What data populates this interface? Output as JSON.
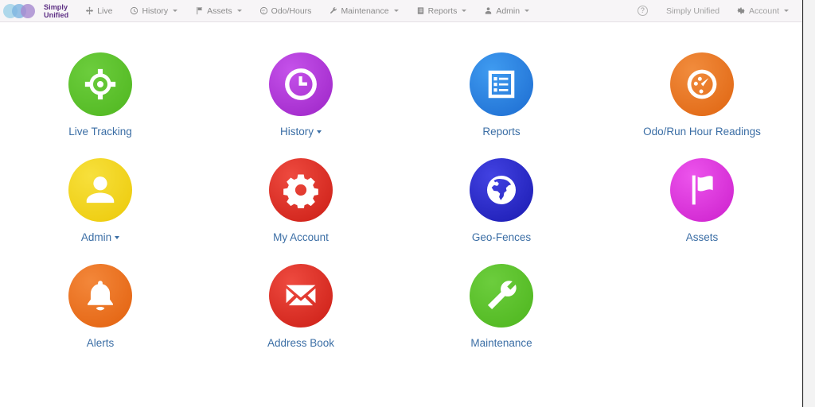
{
  "brand": {
    "line1": "Simply",
    "line2": "Unified",
    "logo_icon": "three-circles-logo"
  },
  "navbar": {
    "left_items": [
      {
        "label": "Live",
        "icon": "crosshair-icon",
        "caret": false
      },
      {
        "label": "History",
        "icon": "clock-icon",
        "caret": true
      },
      {
        "label": "Assets",
        "icon": "flag-icon",
        "caret": true
      },
      {
        "label": "Odo/Hours",
        "icon": "gauge-icon",
        "caret": false
      },
      {
        "label": "Maintenance",
        "icon": "wrench-icon",
        "caret": true
      },
      {
        "label": "Reports",
        "icon": "report-icon",
        "caret": true
      },
      {
        "label": "Admin",
        "icon": "user-icon",
        "caret": true
      }
    ],
    "help_label": "?",
    "help_icon": "help-circle-icon",
    "account_name": "Simply Unified",
    "account_menu": {
      "label": "Account",
      "icon": "gear-icon",
      "caret": true
    }
  },
  "tiles": [
    {
      "label": "Live Tracking",
      "icon": "crosshair-target-icon",
      "color": "#5cc22e",
      "color2": "#49b31f",
      "caret": false
    },
    {
      "label": "History",
      "icon": "clock-icon",
      "color": "#b83ce0",
      "color2": "#9b27c9",
      "caret": true
    },
    {
      "label": "Reports",
      "icon": "report-list-icon",
      "color": "#2e8de8",
      "color2": "#1b6fd6",
      "caret": false
    },
    {
      "label": "Odo/Run Hour Readings",
      "icon": "gauge-icon",
      "color": "#ec7a2a",
      "color2": "#e06410",
      "caret": false
    },
    {
      "label": "Admin",
      "icon": "user-icon",
      "color": "#f2d420",
      "color2": "#e9c50a",
      "caret": true
    },
    {
      "label": "My Account",
      "icon": "gear-icon",
      "color": "#e5332a",
      "color2": "#cc1f17",
      "caret": false
    },
    {
      "label": "Geo-Fences",
      "icon": "globe-icon",
      "color": "#2f2fd4",
      "color2": "#1a1ab5",
      "caret": false
    },
    {
      "label": "Assets",
      "icon": "flag-icon",
      "color": "#e03ce0",
      "color2": "#cc1fcc",
      "caret": false
    },
    {
      "label": "Alerts",
      "icon": "bell-icon",
      "color": "#ef7a2a",
      "color2": "#e3620f",
      "caret": false
    },
    {
      "label": "Address Book",
      "icon": "envelope-icon",
      "color": "#e5332a",
      "color2": "#cc1f17",
      "caret": false
    },
    {
      "label": "Maintenance",
      "icon": "wrench-icon",
      "color": "#5cc22e",
      "color2": "#48b31e",
      "caret": false
    }
  ]
}
